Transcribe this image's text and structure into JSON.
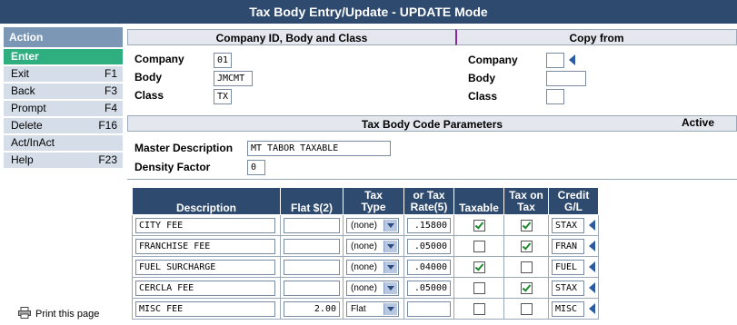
{
  "window": {
    "title": "Tax Body Entry/Update - UPDATE Mode"
  },
  "sidebar": {
    "header": "Action",
    "items": [
      {
        "label": "Enter",
        "key": ""
      },
      {
        "label": "Exit",
        "key": "F1"
      },
      {
        "label": "Back",
        "key": "F3"
      },
      {
        "label": "Prompt",
        "key": "F4"
      },
      {
        "label": "Delete",
        "key": "F16"
      },
      {
        "label": "Act/InAct",
        "key": ""
      },
      {
        "label": "Help",
        "key": "F23"
      }
    ],
    "print_label": "Print this page"
  },
  "company_section": {
    "header": "Company ID, Body and Class",
    "copy_header": "Copy from",
    "company_label": "Company",
    "company_value": "01",
    "body_label": "Body",
    "body_value": "JMCMT",
    "class_label": "Class",
    "class_value": "TX",
    "copy_company_label": "Company",
    "copy_body_label": "Body",
    "copy_class_label": "Class"
  },
  "params_section": {
    "header": "Tax Body Code Parameters",
    "status": "Active",
    "master_label": "Master Description",
    "master_value": "MT TABOR TAXABLE",
    "density_label": "Density Factor",
    "density_value": "0"
  },
  "table": {
    "headers": {
      "description": "Description",
      "flat": "Flat $(2)",
      "tax_type_1": "Tax",
      "tax_type_2": "Type",
      "rate_1": "or Tax",
      "rate_2": "Rate(5)",
      "taxable": "Taxable",
      "taxon_1": "Tax on",
      "taxon_2": "Tax",
      "credit_1": "Credit",
      "credit_2": "G/L"
    },
    "rows": [
      {
        "description": "CITY FEE",
        "flat": "",
        "type": "(none)",
        "rate": ".15800",
        "taxable": true,
        "tax_on_tax": true,
        "credit": "STAX"
      },
      {
        "description": "FRANCHISE FEE",
        "flat": "",
        "type": "(none)",
        "rate": ".05000",
        "taxable": false,
        "tax_on_tax": true,
        "credit": "FRAN"
      },
      {
        "description": "FUEL SURCHARGE",
        "flat": "",
        "type": "(none)",
        "rate": ".04000",
        "taxable": true,
        "tax_on_tax": false,
        "credit": "FUEL"
      },
      {
        "description": "CERCLA FEE",
        "flat": "",
        "type": "(none)",
        "rate": ".05000",
        "taxable": false,
        "tax_on_tax": true,
        "credit": "STAX"
      },
      {
        "description": "MISC FEE",
        "flat": "2.00",
        "type": "Flat",
        "rate": "",
        "taxable": false,
        "tax_on_tax": false,
        "credit": "MISC"
      }
    ]
  }
}
